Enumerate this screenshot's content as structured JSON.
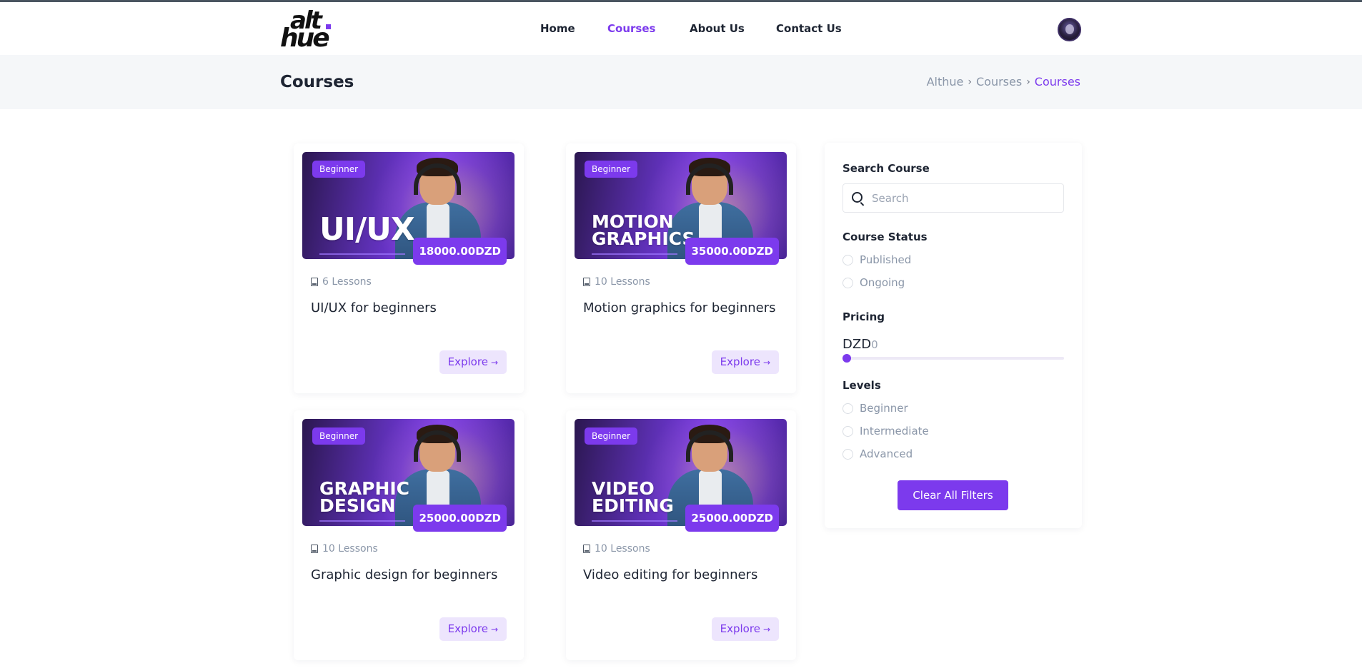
{
  "header": {
    "logo_line1": "alt",
    "logo_line2": "hue",
    "nav": [
      {
        "label": "Home",
        "active": false
      },
      {
        "label": "Courses",
        "active": true
      },
      {
        "label": "About Us",
        "active": false
      },
      {
        "label": "Contact Us",
        "active": false
      }
    ]
  },
  "page": {
    "title": "Courses",
    "breadcrumb": [
      "Althue",
      "Courses",
      "Courses"
    ]
  },
  "courses": [
    {
      "level": "Beginner",
      "thumb_text": "UI/UX",
      "price": "18000.00DZD",
      "lessons": "6 Lessons",
      "title": "UI/UX for beginners",
      "cta": "Explore"
    },
    {
      "level": "Beginner",
      "thumb_text": "MOTION\nGRAPHICS",
      "price": "35000.00DZD",
      "lessons": "10 Lessons",
      "title": "Motion graphics for beginners",
      "cta": "Explore"
    },
    {
      "level": "Beginner",
      "thumb_text": "GRAPHIC\nDESIGN",
      "price": "25000.00DZD",
      "lessons": "10 Lessons",
      "title": "Graphic design for beginners",
      "cta": "Explore"
    },
    {
      "level": "Beginner",
      "thumb_text": "VIDEO\nEDITING",
      "price": "25000.00DZD",
      "lessons": "10 Lessons",
      "title": "Video editing for beginners",
      "cta": "Explore"
    }
  ],
  "filters": {
    "search_label": "Search Course",
    "search_placeholder": "Search",
    "search_value": "",
    "status_label": "Course Status",
    "status_options": [
      "Published",
      "Ongoing"
    ],
    "pricing_label": "Pricing",
    "pricing_currency": "DZD",
    "pricing_value": "0",
    "levels_label": "Levels",
    "level_options": [
      "Beginner",
      "Intermediate",
      "Advanced"
    ],
    "clear_label": "Clear All Filters"
  },
  "colors": {
    "accent": "#7c3aed",
    "accent_soft": "#ede5fd",
    "band_bg": "#f5f7f9"
  },
  "icons": {
    "search": "search-icon",
    "lessons": "book-icon",
    "explore_arrow": "arrow-right-icon",
    "breadcrumb_sep": "chevron-right-icon"
  }
}
